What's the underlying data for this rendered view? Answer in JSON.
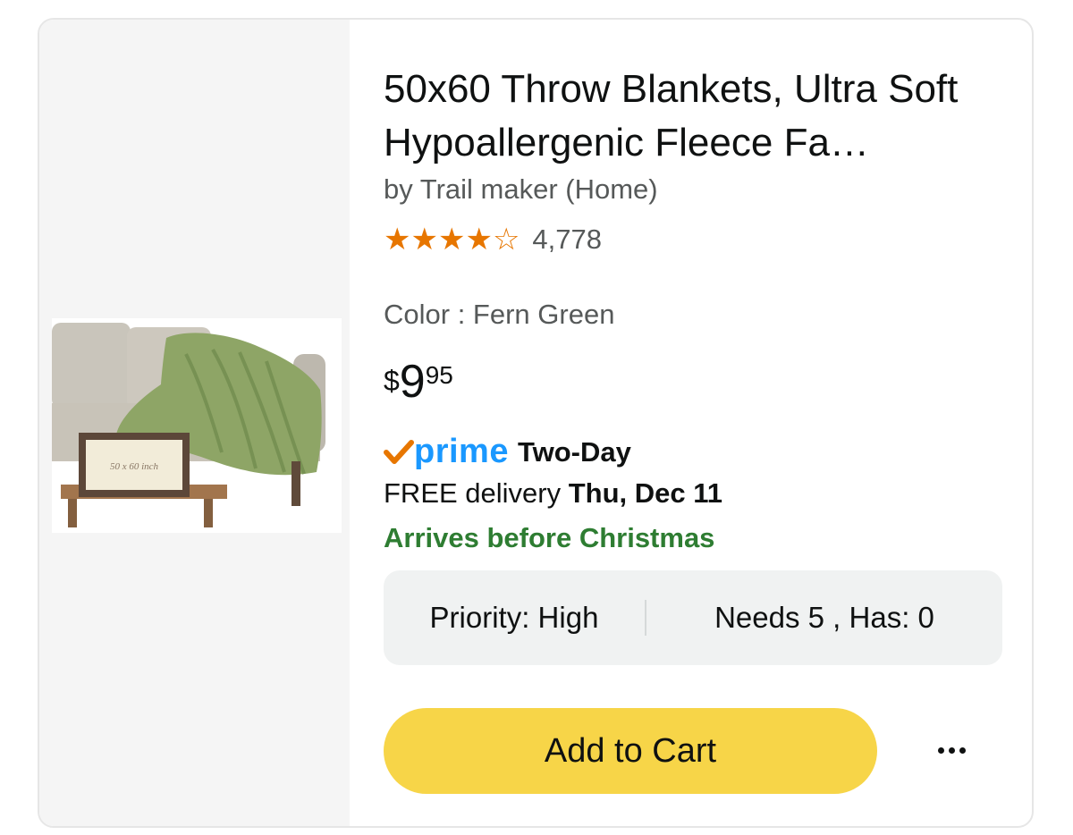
{
  "product": {
    "title": "50x60 Throw Blankets, Ultra Soft Hypoallergenic Fleece Fa…",
    "brand": "by Trail maker (Home)",
    "rating": 4.5,
    "rating_count": "4,778",
    "variant": "Color : Fern Green",
    "price": {
      "symbol": "$",
      "whole": "9",
      "fraction": "95"
    },
    "image_label": "50 x 60 inch"
  },
  "delivery": {
    "prime_label": "prime",
    "speed": "Two-Day",
    "free_prefix": "FREE delivery",
    "date": "Thu, Dec 11",
    "arrival_note": "Arrives before Christmas"
  },
  "wishlist": {
    "priority": "Priority: High",
    "needs_has": "Needs 5 , Has: 0"
  },
  "actions": {
    "add_to_cart": "Add to Cart",
    "more_icon": "more-horizontal-icon"
  },
  "colors": {
    "star": "#e77600",
    "prime_blue": "#1a98ff",
    "arrival_green": "#2e7d32",
    "cart_button": "#f7d548"
  }
}
